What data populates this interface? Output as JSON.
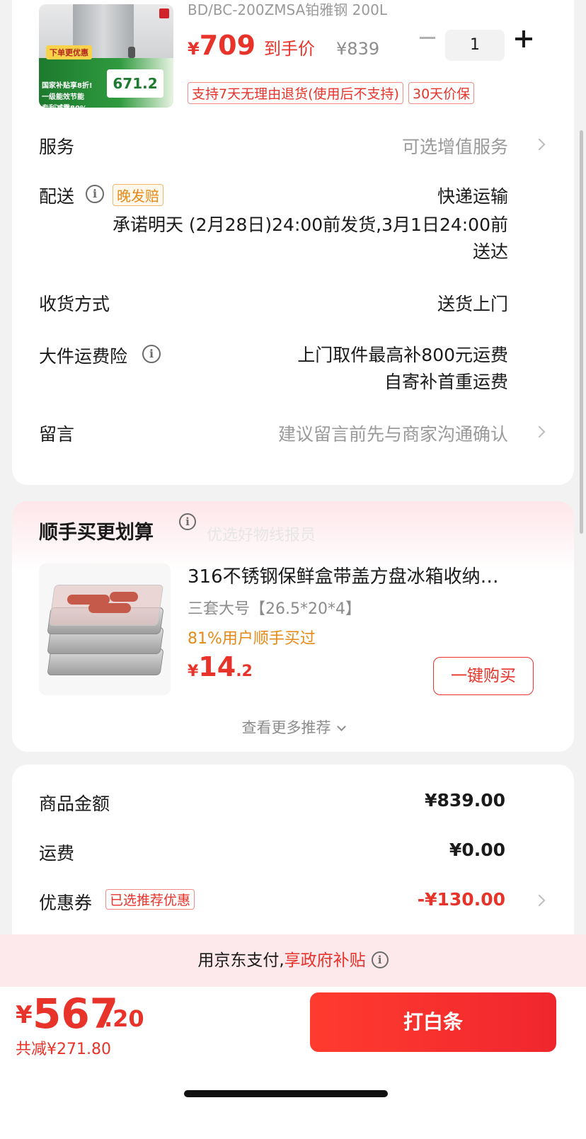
{
  "product": {
    "sku_text": "BD/BC-200ZMSA铂雅钢 200L",
    "price_yen": "¥",
    "price_value": "709",
    "price_tag": "到手价",
    "original_price": "¥839",
    "quantity": "1",
    "tags": [
      "支持7天无理由退货(使用后不支持)",
      "30天价保"
    ],
    "image": {
      "badge": "下单更优惠",
      "promo_line1": "国家补贴享8折!",
      "promo_line2": "一级能效节能",
      "promo_line3": "专利减霜80%",
      "price_text": "671.2"
    }
  },
  "service": {
    "label": "服务",
    "value": "可选增值服务"
  },
  "delivery": {
    "label": "配送",
    "badge": "晚发赔",
    "method": "快递运输",
    "promise_line1": "承诺明天 (2月28日)24:00前发货,3月1日24:00前",
    "promise_line2": "送达"
  },
  "receive": {
    "label": "收货方式",
    "value": "送货上门"
  },
  "insurance": {
    "label": "大件运费险",
    "line1": "上门取件最高补800元运费",
    "line2": "自寄补首重运费"
  },
  "message": {
    "label": "留言",
    "value": "建议留言前先与商家沟通确认"
  },
  "recommend": {
    "title": "顺手买更划算",
    "watermark": "优选好物线报员",
    "item_name": "316不锈钢保鲜盒带盖方盘冰箱收纳…",
    "item_spec": "三套大号【26.5*20*4】",
    "item_bought": "81%用户顺手买过",
    "price_yen": "¥",
    "price_int": "14",
    "price_dec": ".2",
    "buy_label": "一键购买",
    "more_label": "查看更多推荐"
  },
  "amounts": {
    "goods_label": "商品金额",
    "goods_value": "¥839.00",
    "shipping_label": "运费",
    "shipping_value": "¥0.00",
    "coupon_label": "优惠券",
    "coupon_badge": "已选推荐优惠",
    "coupon_value": "-¥130.00"
  },
  "pay_banner": {
    "text": "用京东支付,",
    "highlight": "享政府补贴"
  },
  "bottom": {
    "yen": "¥",
    "total_int": "567",
    "total_dec": ".20",
    "saved": "共减¥271.80",
    "pay_button": "打白条"
  },
  "colors": {
    "accent": "#e8332a",
    "warning": "#e58a17",
    "banner_bg": "#fde8ec"
  }
}
